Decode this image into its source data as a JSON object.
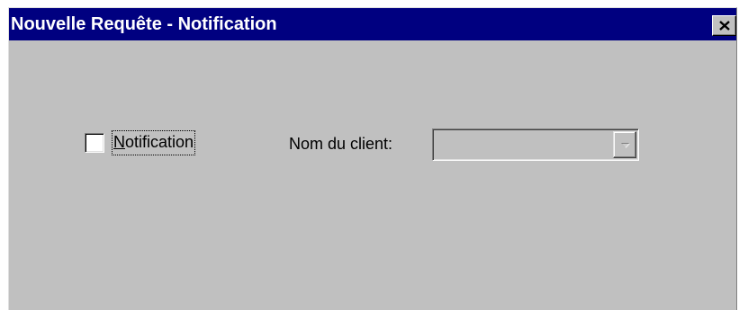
{
  "window": {
    "title": "Nouvelle Requête - Notification",
    "close_icon": "close-icon"
  },
  "form": {
    "notification_checkbox": {
      "label_accel": "N",
      "label_rest": "otification",
      "checked": false
    },
    "client_name": {
      "label": "Nom du client:",
      "value": "",
      "enabled": false,
      "dropdown_icon": "chevron-down-icon"
    }
  },
  "colors": {
    "titlebar": "#000080",
    "face": "#c0c0c0",
    "disabled_text": "#808080"
  }
}
